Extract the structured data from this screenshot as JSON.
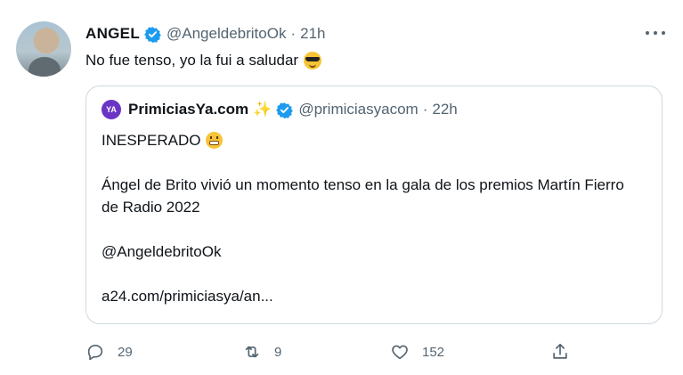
{
  "tweet": {
    "name": "ANGEL",
    "handle": "@AngeldebritoOk",
    "separator": "·",
    "time": "21h",
    "text": "No fue tenso, yo la fui a saludar",
    "text_emoji": "smiling-face-with-sunglasses"
  },
  "quote": {
    "avatar_text": "YA",
    "name": "PrimiciasYa.com",
    "name_emoji": "sparkles",
    "handle": "@primiciasyacom",
    "separator": "·",
    "time": "22h",
    "line1": "INESPERADO",
    "line1_emoji": "grimacing-face",
    "line2": "Ángel de Brito vivió un momento tenso en la gala de los premios Martín Fierro de Radio 2022",
    "line3": "@AngeldebritoOk",
    "line4": "a24.com/primiciasya/an..."
  },
  "actions": {
    "replies": "29",
    "retweets": "9",
    "likes": "152"
  },
  "colors": {
    "verified": "#1d9bf0",
    "muted": "#536471",
    "border": "#cfd9de",
    "text": "#0f1419",
    "brand_purple": "#6a35c4"
  }
}
